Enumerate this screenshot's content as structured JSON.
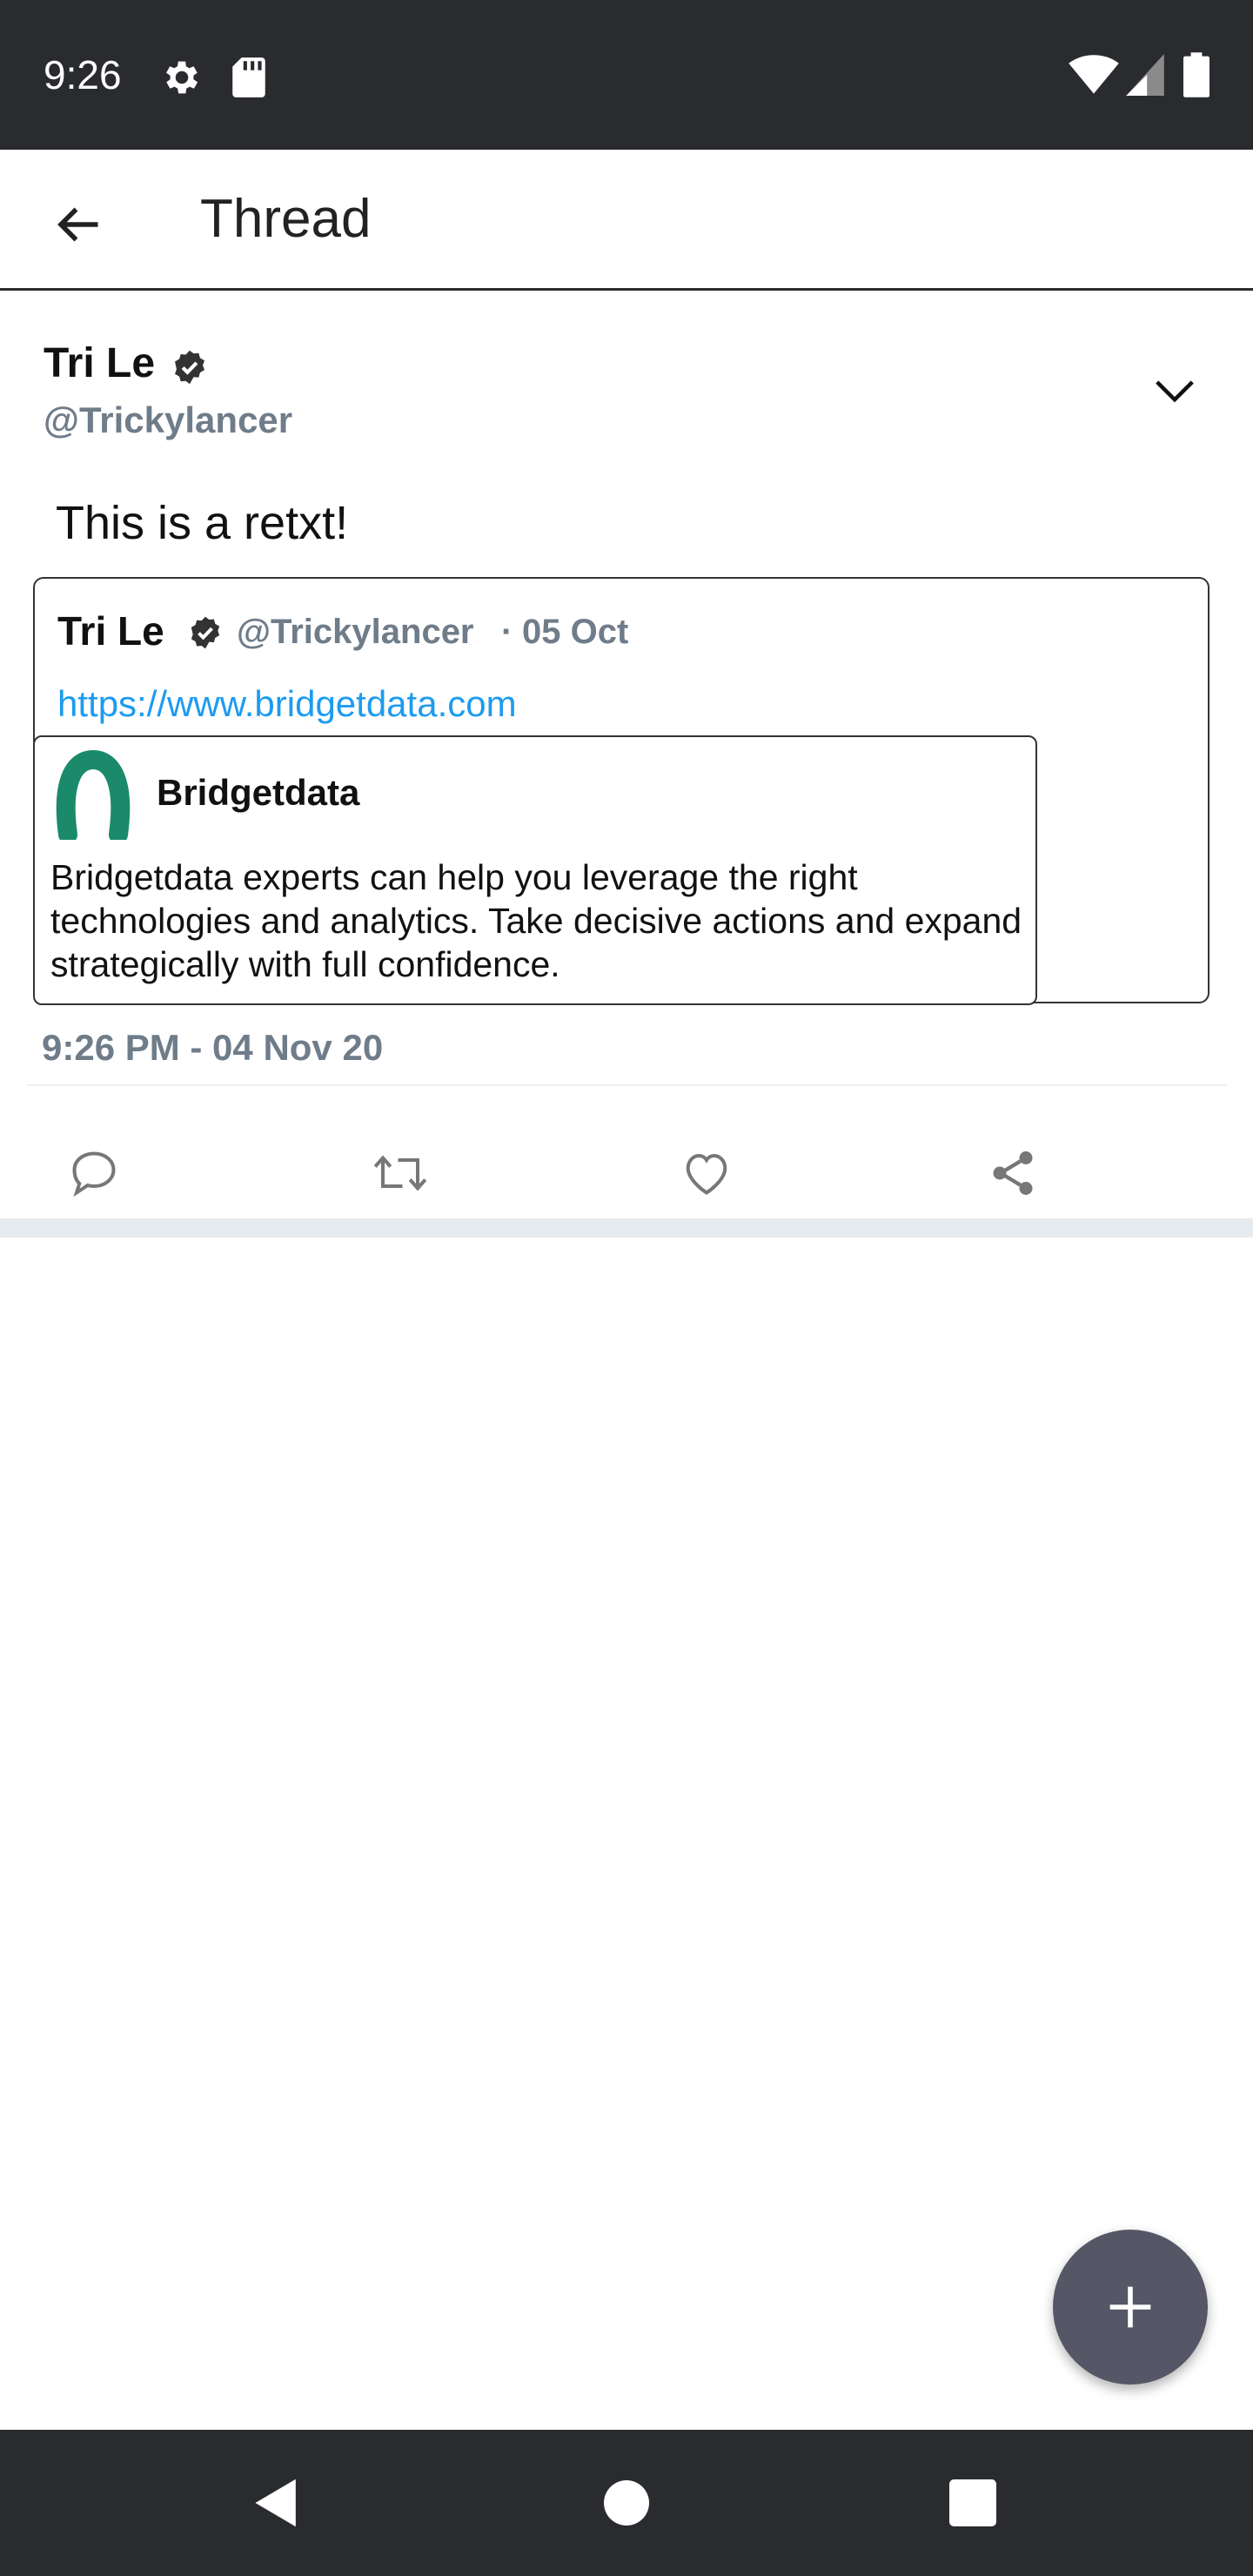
{
  "status_bar": {
    "time": "9:26",
    "icons": [
      "gear-icon",
      "sd-card-icon",
      "wifi-icon",
      "signal-icon",
      "battery-icon"
    ]
  },
  "app_bar": {
    "title": "Thread",
    "back_icon": "arrow-left-icon"
  },
  "tweet": {
    "author_name": "Tri Le",
    "author_handle": "@Trickylancer",
    "text": "This is a retxt!",
    "timestamp": "9:26 PM - 04 Nov 20",
    "quoted": {
      "author_name": "Tri Le",
      "author_handle": "@Trickylancer",
      "separator": "·",
      "date": "05 Oct",
      "link": "https://www.bridgetdata.com",
      "preview": {
        "title": "Bridgetdata",
        "description": "Bridgetdata experts can help you leverage the right technologies and analytics. Take decisive actions and expand strategically with full confidence."
      }
    },
    "actions": [
      "reply-icon",
      "retweet-icon",
      "like-icon",
      "share-icon"
    ]
  },
  "colors": {
    "status_bar_bg": "#2a2b2f",
    "handle_gray": "#6f7c89",
    "link_blue": "#1d9bf0",
    "fab_bg": "#555666",
    "logo_green": "#1a8a6a"
  },
  "fab": {
    "icon": "plus-icon"
  },
  "nav_bar": {
    "buttons": [
      "back-triangle-icon",
      "home-circle-icon",
      "recents-square-icon"
    ]
  }
}
